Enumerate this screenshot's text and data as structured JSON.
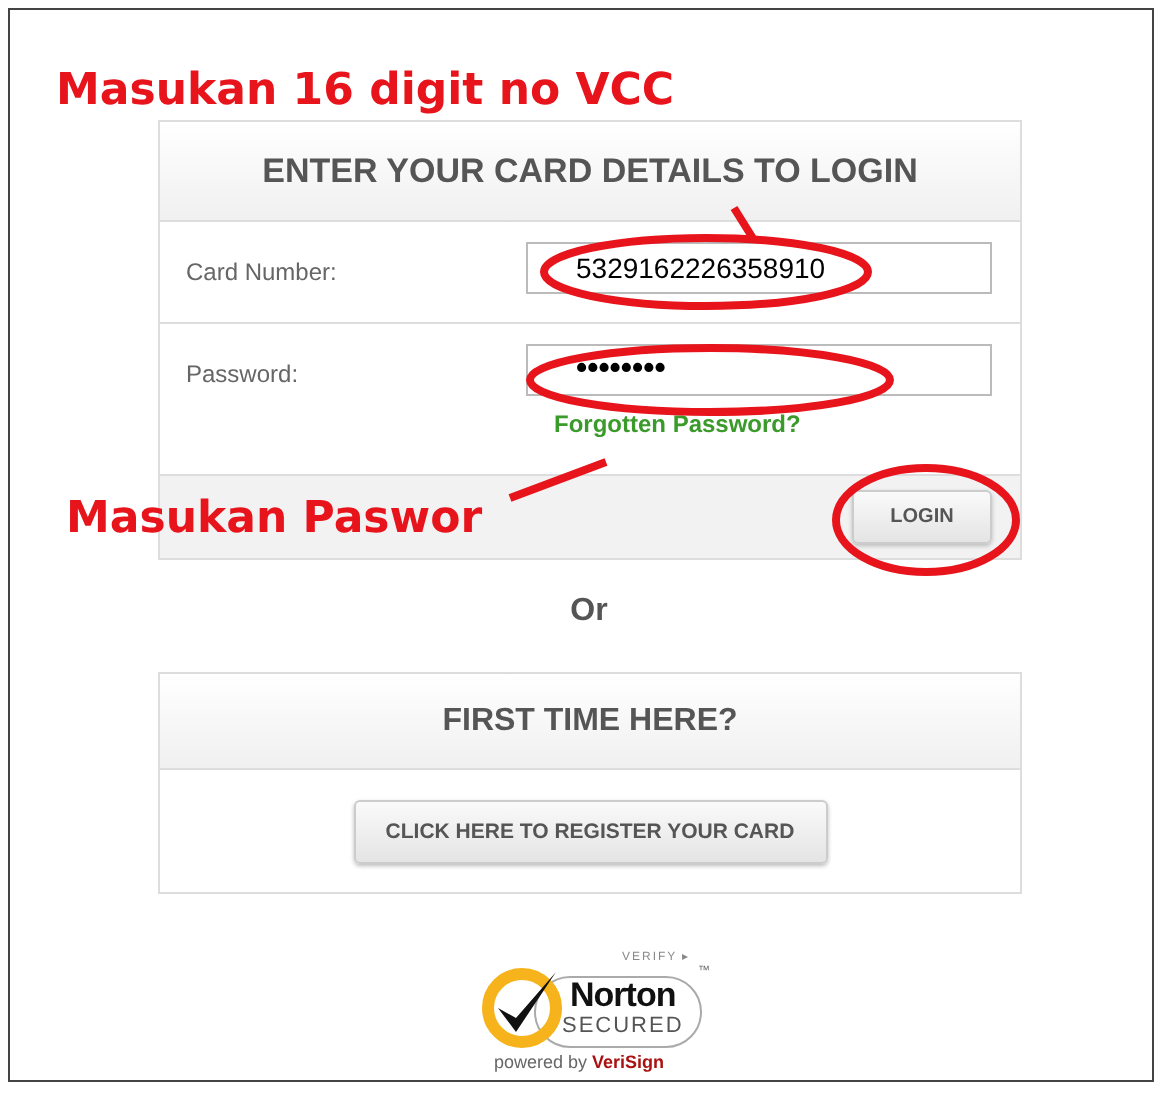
{
  "login": {
    "title": "ENTER YOUR CARD DETAILS TO LOGIN",
    "fields": [
      {
        "label": "Card Number:",
        "kind": "text",
        "value": "5329162226358910"
      },
      {
        "label": "Password:",
        "kind": "password",
        "value": "••••••••",
        "link": "Forgotten Password?"
      }
    ],
    "button": "LOGIN"
  },
  "separator": "Or",
  "register": {
    "title": "FIRST TIME HERE?",
    "button": "CLICK HERE TO REGISTER YOUR CARD"
  },
  "seal": {
    "verify": "VERIFY ▸",
    "brand": "Norton",
    "secured": "SECURED",
    "tm": "™",
    "powered": "powered by **VeriSign**"
  },
  "annotations": [
    {
      "kind": "label",
      "text": "Masukan 16 digit no VCC"
    },
    {
      "kind": "label",
      "text": "Masukan Paswor"
    }
  ]
}
